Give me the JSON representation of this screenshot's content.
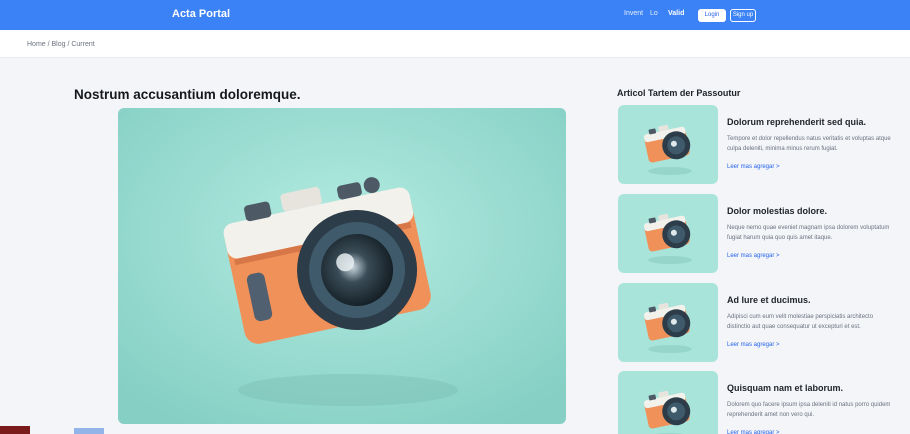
{
  "header": {
    "brand": "Acta Portal",
    "nav": [
      "Invent",
      "Lo",
      "Valid"
    ],
    "buttons": [
      "Login",
      "Sign up"
    ]
  },
  "breadcrumb": "Home / Blog / Current",
  "main": {
    "title": "Nostrum accusantium doloremque.",
    "image_icon": "camera-illustration"
  },
  "sidebar": {
    "title": "Articol Tartem der Passoutur",
    "cards": [
      {
        "title": "Dolorum reprehenderit sed quia.",
        "text": "Tempore et dolor repellendus natus veritatis et voluptas atque culpa deleniti, minima minus rerum fugiat.",
        "link": "Leer mas agregar >"
      },
      {
        "title": "Dolor molestias dolore.",
        "text": "Neque nemo quae eveniet magnam ipsa dolorem voluptatum fugiat harum quia quo quis amet itaque.",
        "link": "Leer mas agregar >"
      },
      {
        "title": "Ad Iure et ducimus.",
        "text": "Adipisci cum eum velit molestiae perspiciatis architecto distinctio aut quae consequatur ut excepturi et est.",
        "link": "Leer mas agregar >"
      },
      {
        "title": "Quisquam nam et laborum.",
        "text": "Dolorem quo facere ipsum ipsa deleniti id natus porro quidem reprehenderit amet non vero qui.",
        "link": "Leer mas agregar >"
      }
    ]
  },
  "colors": {
    "accent": "#3b82f6",
    "image_bg": "#9fded4",
    "camera_body": "#f0915a"
  }
}
